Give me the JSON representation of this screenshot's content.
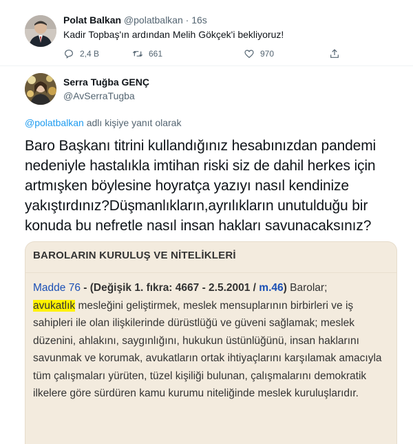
{
  "tweet1": {
    "name": "Polat Balkan",
    "handle": "@polatbalkan",
    "separator": "·",
    "time": "16s",
    "text": "Kadir Topbaş'ın ardından Melih Gökçek'i bekliyoruz!",
    "actions": {
      "reply_count": "2,4 B",
      "retweet_count": "661",
      "like_count": "970"
    }
  },
  "tweet2": {
    "name": "Serra Tuğba GENÇ",
    "handle": "@AvSerraTugba",
    "reply_to_handle": "@polatbalkan",
    "reply_to_suffix": " adlı kişiye yanıt olarak",
    "text": "Baro Başkanı titrini kullandığınız hesabınızdan pandemi nedeniyle hastalıkla imtihan riski siz de dahil herkes için artmışken böylesine hoyratça yazıyı nasıl kendinize yakıştırdınız?Düşmanlıkların,ayrılıkların unutulduğu bir konuda bu nefretle nasıl insan hakları savunacaksınız?"
  },
  "media": {
    "title": "BAROLARIN KURULUŞ VE NİTELİKLERİ",
    "madde": "Madde 76",
    "dash": " - ",
    "change_prefix": "(Değişik 1. fıkra: 4667 - 2.5.2001 / ",
    "change_ref": "m.46",
    "change_suffix": ")",
    "after_change": " Barolar;",
    "highlight": "avukatlık",
    "rest": " mesleğini geliştirmek, meslek mensuplarının birbirleri ve iş sahipleri ile olan ilişkilerinde dürüstlüğü ve güveni sağlamak; meslek düzenini, ahlakını, saygınlığını, hukukun üstünlüğünü, insan haklarını savunmak ve korumak, avukatların ortak ihtiyaçlarını karşılamak amacıyla tüm çalışmaları yürüten, tüzel kişiliği bulunan, çalışmalarını demokratik ilkelere göre sürdüren kamu kurumu niteliğinde meslek kuruluşlarıdır."
  },
  "icons": {
    "reply": "reply-icon",
    "retweet": "retweet-icon",
    "like": "heart-icon",
    "share": "share-icon"
  },
  "colors": {
    "link_blue": "#1d9bf0",
    "muted": "#536471",
    "media_bg": "#f3ebde",
    "highlight": "#fff200"
  }
}
